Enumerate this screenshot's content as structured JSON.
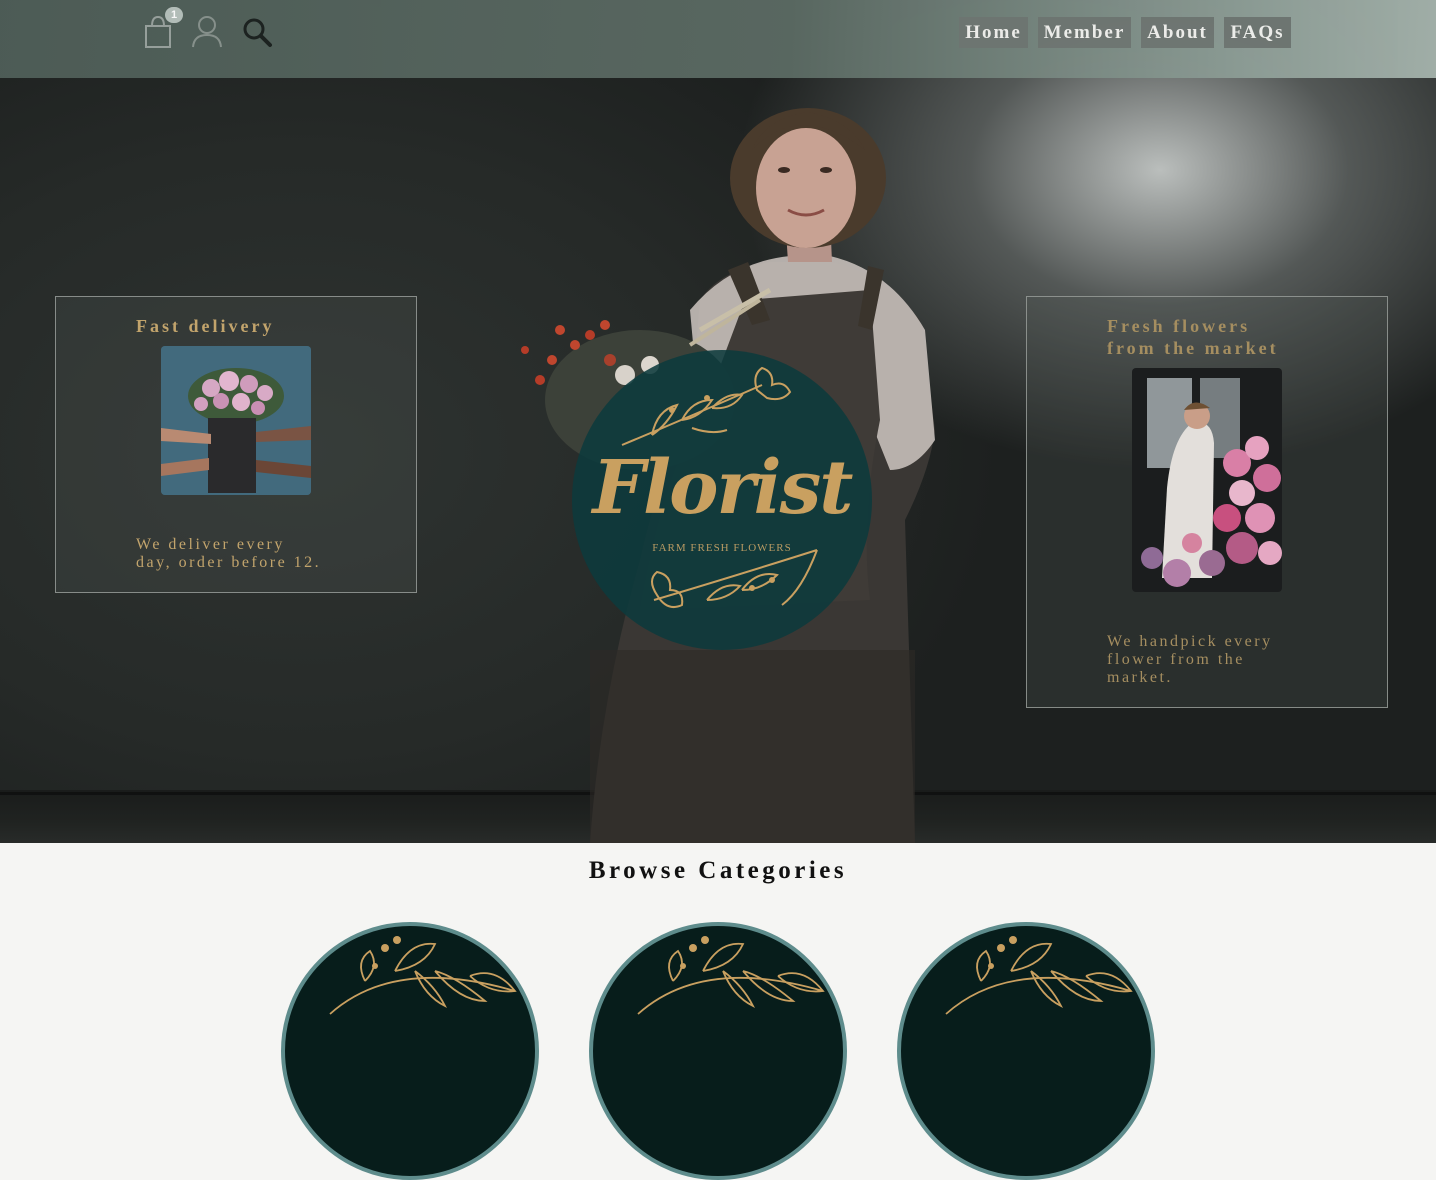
{
  "header": {
    "cart_count": "1",
    "nav": [
      {
        "label": "Home"
      },
      {
        "label": "Member"
      },
      {
        "label": "About"
      },
      {
        "label": "FAQs"
      }
    ]
  },
  "hero": {
    "left_card": {
      "title": "Fast delivery",
      "text_line1": "We deliver every",
      "text_line2": "day, order before 12."
    },
    "right_card": {
      "title_line1": "Fresh flowers",
      "title_line2": "from the market",
      "text_line1": "We handpick every",
      "text_line2": "flower from the",
      "text_line3": "market."
    },
    "logo": {
      "word": "Florist",
      "sub": "FARM FRESH FLOWERS"
    }
  },
  "browse": {
    "title": "Browse Categories"
  },
  "colors": {
    "gold": "#c2a46c",
    "teal_dark": "#071d1b",
    "teal_ring": "#5e8c8c",
    "nav_bg": "#6f7773"
  }
}
